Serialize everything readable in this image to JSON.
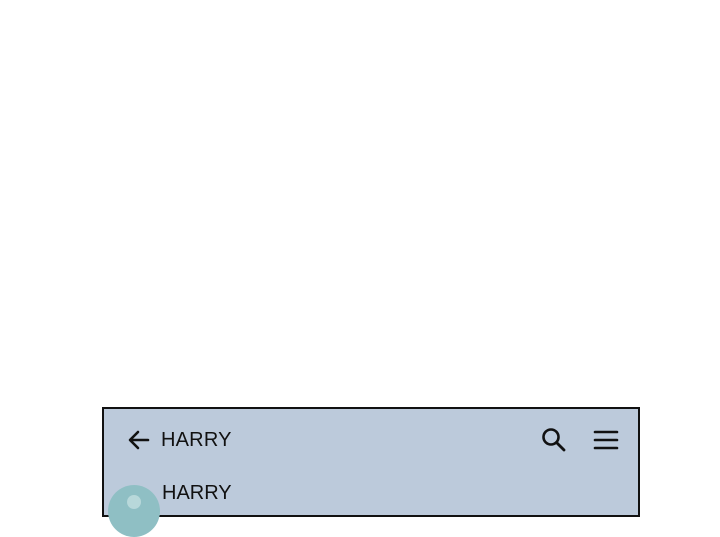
{
  "app_bar": {
    "title": "HARRY",
    "back_icon": "arrow-left-icon",
    "search_icon": "search-icon",
    "menu_icon": "hamburger-menu-icon"
  },
  "message": {
    "sender": "HARRY",
    "avatar_icon": "person-avatar-icon"
  },
  "colors": {
    "page_background": "#ffffff",
    "chat_background": "#bccadb",
    "frame_border": "#111111",
    "avatar": "#8fbfc4"
  }
}
